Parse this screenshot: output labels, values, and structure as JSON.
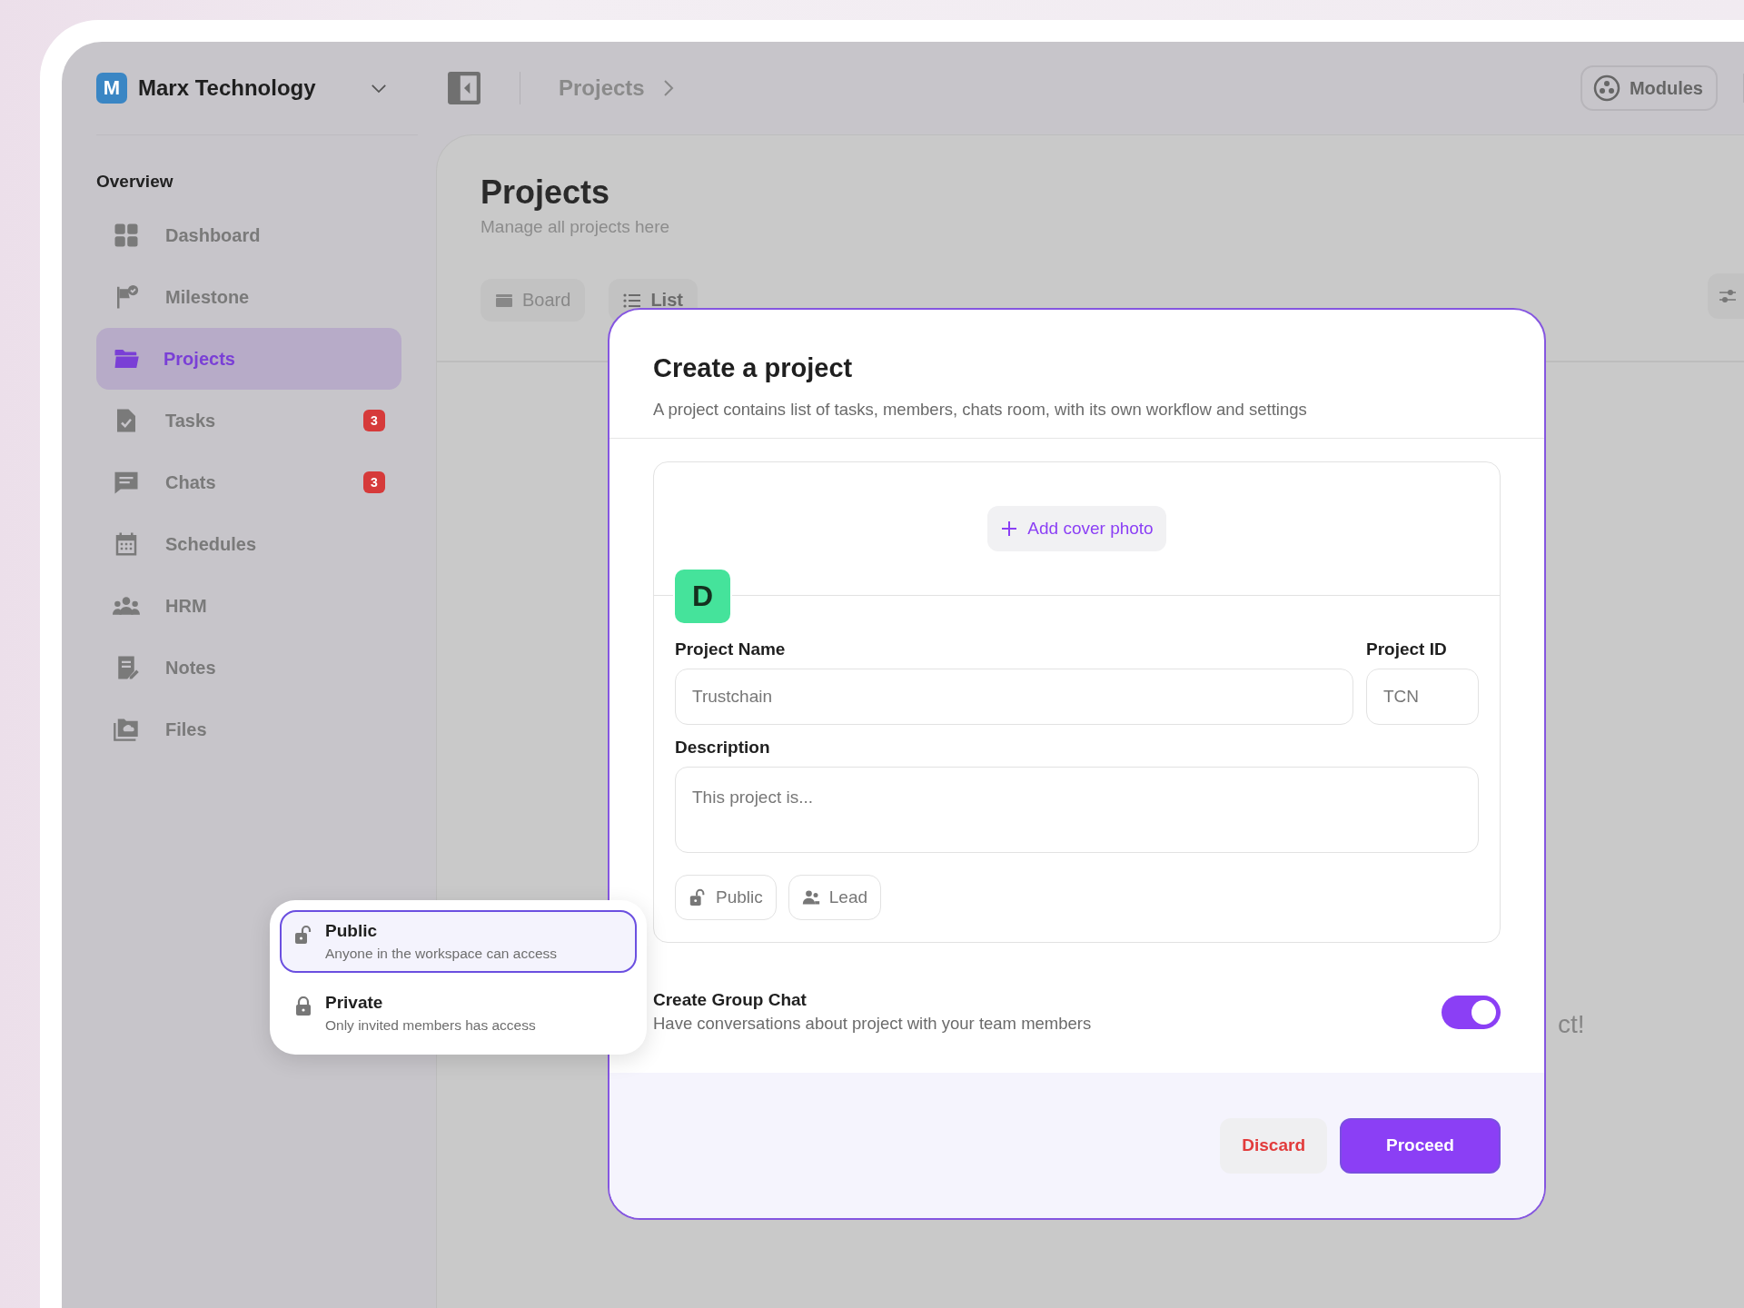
{
  "workspace": {
    "initial": "M",
    "name": "Marx Technology"
  },
  "breadcrumb": [
    "Projects"
  ],
  "modules_button": "Modules",
  "sidebar": {
    "section": "Overview",
    "items": [
      {
        "label": "Dashboard",
        "selected": false
      },
      {
        "label": "Milestone",
        "selected": false
      },
      {
        "label": "Projects",
        "selected": true
      },
      {
        "label": "Tasks",
        "selected": false,
        "badge": "3"
      },
      {
        "label": "Chats",
        "selected": false,
        "badge": "3"
      },
      {
        "label": "Schedules",
        "selected": false
      },
      {
        "label": "HRM",
        "selected": false
      },
      {
        "label": "Notes",
        "selected": false
      },
      {
        "label": "Files",
        "selected": false
      }
    ]
  },
  "page": {
    "title": "Projects",
    "subtitle": "Manage all projects here",
    "views": [
      {
        "label": "Board",
        "selected": false
      },
      {
        "label": "List",
        "selected": true
      }
    ],
    "background_text": "ct!"
  },
  "modal": {
    "title": "Create a project",
    "description": "A project contains list of tasks, members, chats room, with its own workflow and settings",
    "add_cover": "Add cover photo",
    "avatar_initial": "D",
    "fields": [
      {
        "label": "Project Name",
        "placeholder": "Trustchain"
      },
      {
        "label": "Project ID",
        "placeholder": "TCN"
      }
    ],
    "description_field": {
      "label": "Description",
      "placeholder": "This project is..."
    },
    "chips": [
      {
        "label": "Public",
        "kind": "visibility"
      },
      {
        "label": "Lead",
        "kind": "lead"
      }
    ],
    "group_chat": {
      "title": "Create Group Chat",
      "description": "Have conversations about project with your team members",
      "on": true
    },
    "buttons": [
      {
        "label": "Discard",
        "kind": "secondary"
      },
      {
        "label": "Proceed",
        "kind": "primary"
      }
    ]
  },
  "visibility_menu": {
    "options": [
      {
        "label": "Public",
        "description": "Anyone in the workspace can access",
        "selected": true
      },
      {
        "label": "Private",
        "description": "Only invited members has access",
        "selected": false
      }
    ]
  }
}
